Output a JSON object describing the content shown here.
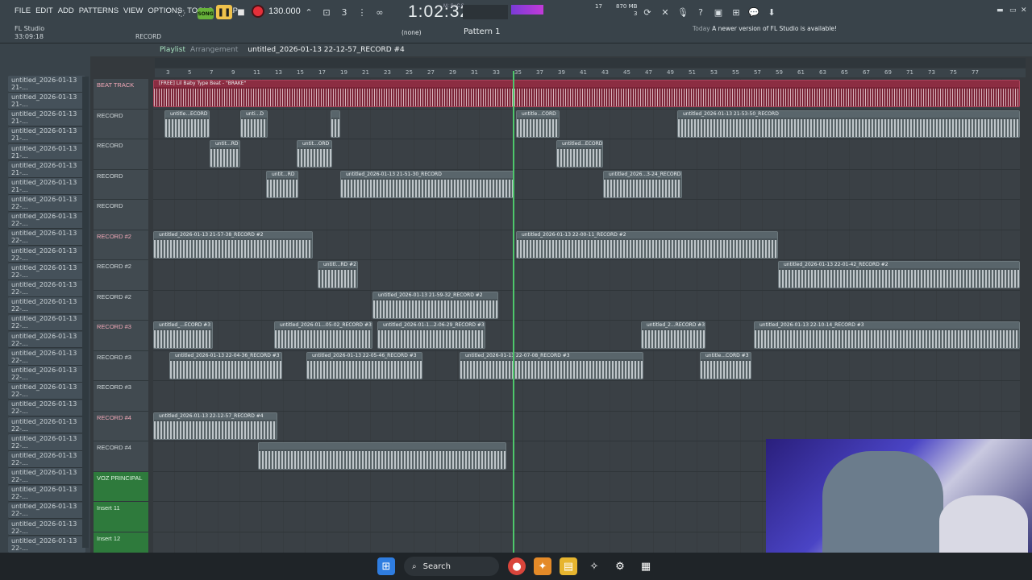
{
  "menu": [
    "FILE",
    "EDIT",
    "ADD",
    "PATTERNS",
    "VIEW",
    "OPTIONS",
    "TOOLS",
    "HELP"
  ],
  "app": {
    "name": "FL Studio",
    "elapsed": "33:09:18"
  },
  "transport": {
    "song_label": "SONG",
    "tempo": "130.000",
    "time": "1:02:32",
    "time_unit": "M:S:CS",
    "record_label": "RECORD",
    "cpu": "17",
    "memory": "870 MB",
    "memory_sub": "3"
  },
  "toolbar2": {
    "none_label": "(none)",
    "pattern": "Pattern 1"
  },
  "news": {
    "prefix": "Today",
    "text": "A newer version of FL Studio is available!"
  },
  "playlist": {
    "title": "Playlist",
    "subtitle": "Arrangement",
    "file": "untitled_2026-01-13 22-12-57_RECORD #4"
  },
  "ruler": [
    "3",
    "5",
    "7",
    "9",
    "11",
    "13",
    "15",
    "17",
    "19",
    "21",
    "23",
    "25",
    "27",
    "29",
    "31",
    "33",
    "35",
    "37",
    "39",
    "41",
    "43",
    "45",
    "47",
    "49",
    "51",
    "53",
    "55",
    "57",
    "59",
    "61",
    "63",
    "65",
    "67",
    "69",
    "71",
    "73",
    "75",
    "77"
  ],
  "browser_items": [
    "untitled_2026-01-13 21-...",
    "untitled_2026-01-13 21-...",
    "untitled_2026-01-13 21-...",
    "untitled_2026-01-13 21-...",
    "untitled_2026-01-13 21-...",
    "untitled_2026-01-13 21-...",
    "untitled_2026-01-13 21-...",
    "untitled_2026-01-13 22-...",
    "untitled_2026-01-13 22-...",
    "untitled_2026-01-13 22-...",
    "untitled_2026-01-13 22-...",
    "untitled_2026-01-13 22-...",
    "untitled_2026-01-13 22-...",
    "untitled_2026-01-13 22-...",
    "untitled_2026-01-13 22-...",
    "untitled_2026-01-13 22-...",
    "untitled_2026-01-13 22-...",
    "untitled_2026-01-13 22-...",
    "untitled_2026-01-13 22-...",
    "untitled_2026-01-13 22-...",
    "untitled_2026-01-13 22-...",
    "untitled_2026-01-13 22-...",
    "untitled_2026-01-13 22-...",
    "untitled_2026-01-13 22-...",
    "untitled_2026-01-13 22-...",
    "untitled_2026-01-13 22-...",
    "untitled_2026-01-13 22-...",
    "untitled_2026-01-13 22-..."
  ],
  "tracks": [
    {
      "name": "BEAT TRACK",
      "color": "red",
      "clips": [
        {
          "label": "[FREE] Lil Baby Type Beat - \"BRAKE\"",
          "beat": true
        }
      ]
    },
    {
      "name": "RECORD",
      "color": "",
      "clips": [
        {
          "label": "untitle...ECORD"
        },
        {
          "label": "unti...D"
        },
        {
          "label": ""
        },
        {
          "label": "untitle...CORD"
        },
        {
          "label": "untitled_2026-01-13 21-53-50_RECORD"
        }
      ]
    },
    {
      "name": "RECORD",
      "color": "",
      "clips": [
        {
          "label": "untit...RD"
        },
        {
          "label": "untit...ORD"
        },
        {
          "label": "untitled...ECORD"
        }
      ]
    },
    {
      "name": "RECORD",
      "color": "",
      "clips": [
        {
          "label": "untit...RD"
        },
        {
          "label": "untitled_2026-01-13 21-51-30_RECORD"
        },
        {
          "label": "untitled_2026...3-24_RECORD"
        }
      ]
    },
    {
      "name": "RECORD",
      "color": "",
      "clips": []
    },
    {
      "name": "RECORD #2",
      "color": "red",
      "clips": [
        {
          "label": "untitled_2026-01-13 21-57-38_RECORD #2"
        },
        {
          "label": "untitled_2026-01-13 22-00-11_RECORD #2"
        }
      ]
    },
    {
      "name": "RECORD #2",
      "color": "",
      "clips": [
        {
          "label": "untitl...RD #2"
        },
        {
          "label": "untitled_2026-01-13 22-01-42_RECORD #2"
        }
      ]
    },
    {
      "name": "RECORD #2",
      "color": "",
      "clips": [
        {
          "label": "untitled_2026-01-13 21-59-32_RECORD #2"
        }
      ]
    },
    {
      "name": "RECORD #3",
      "color": "red",
      "clips": [
        {
          "label": "untitled_...ECORD #3"
        },
        {
          "label": "untitled_2026-01...05-02_RECORD #3"
        },
        {
          "label": "untitled_2026-01-1...2-06-29_RECORD #3"
        },
        {
          "label": "untitled_2...RECORD #3"
        },
        {
          "label": "untitled_2026-01-13 22-10-14_RECORD #3"
        }
      ]
    },
    {
      "name": "RECORD #3",
      "color": "",
      "clips": [
        {
          "label": "untitled_2026-01-13 22-04-36_RECORD #3"
        },
        {
          "label": "untitled_2026-01-13 22-05-46_RECORD #3"
        },
        {
          "label": "untitled_2026-01-13 22-07-08_RECORD #3"
        },
        {
          "label": "untitle...CORD #3"
        }
      ]
    },
    {
      "name": "RECORD #3",
      "color": "",
      "clips": []
    },
    {
      "name": "RECORD #4",
      "color": "red",
      "clips": [
        {
          "label": "untitled_2026-01-13 22-12-57_RECORD #4"
        }
      ]
    },
    {
      "name": "RECORD #4",
      "color": "",
      "clips": [
        {
          "label": ""
        }
      ]
    },
    {
      "name": "VOZ PRINCIPAL",
      "color": "green",
      "clips": []
    },
    {
      "name": "Insert 11",
      "color": "green",
      "clips": []
    },
    {
      "name": "Insert 12",
      "color": "green",
      "clips": []
    }
  ],
  "taskbar": {
    "search": "Search"
  }
}
